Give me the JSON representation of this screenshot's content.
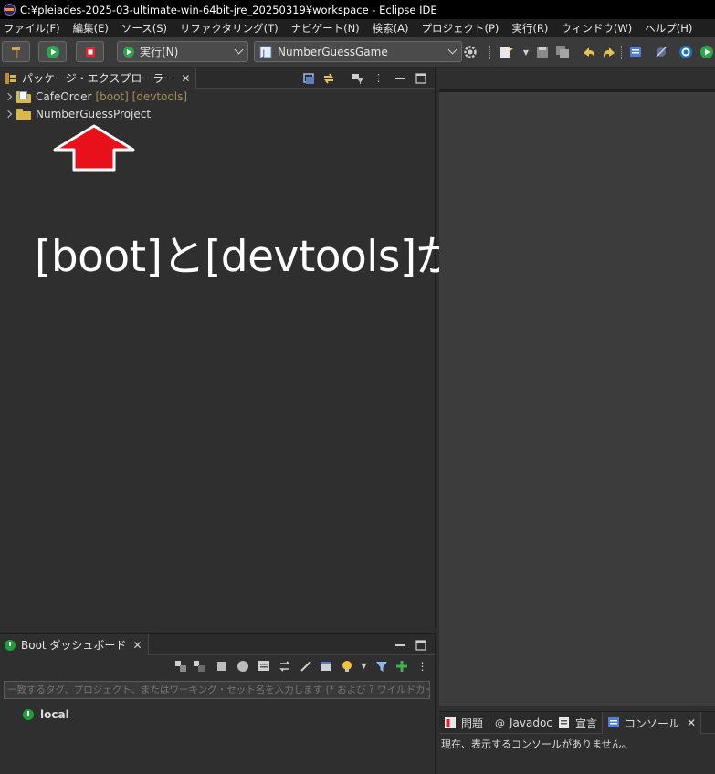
{
  "window": {
    "title": "C:¥pleiades-2025-03-ultimate-win-64bit-jre_20250319¥workspace - Eclipse IDE"
  },
  "menu": [
    "ファイル(F)",
    "編集(E)",
    "ソース(S)",
    "リファクタリング(T)",
    "ナビゲート(N)",
    "検索(A)",
    "プロジェクト(P)",
    "実行(R)",
    "ウィンドウ(W)",
    "ヘルプ(H)"
  ],
  "toolbar": {
    "run_combo": "実行(N)",
    "launch_target": "NumberGuessGame"
  },
  "package_explorer": {
    "tab_label": "パッケージ・エクスプローラー",
    "projects": [
      {
        "name": "CafeOrder",
        "decorations": "[boot] [devtools]"
      },
      {
        "name": "NumberGuessProject",
        "decorations": ""
      }
    ]
  },
  "annotation": {
    "text": "[boot]と[devtools]が追加される",
    "arrow_color": "#e8101a"
  },
  "boot_dashboard": {
    "tab_label": "Boot ダッシュボード",
    "filter_placeholder": "一致するタグ、プロジェクト、またはワーキング・セット名を入力します (* および ? ワイルドカードを含む)",
    "targets": [
      "local"
    ]
  },
  "console_area": {
    "tabs": [
      "問題",
      "Javadoc",
      "宣言",
      "コンソール"
    ],
    "active_tab": "コンソール",
    "message": "現在、表示するコンソールがありません。"
  }
}
